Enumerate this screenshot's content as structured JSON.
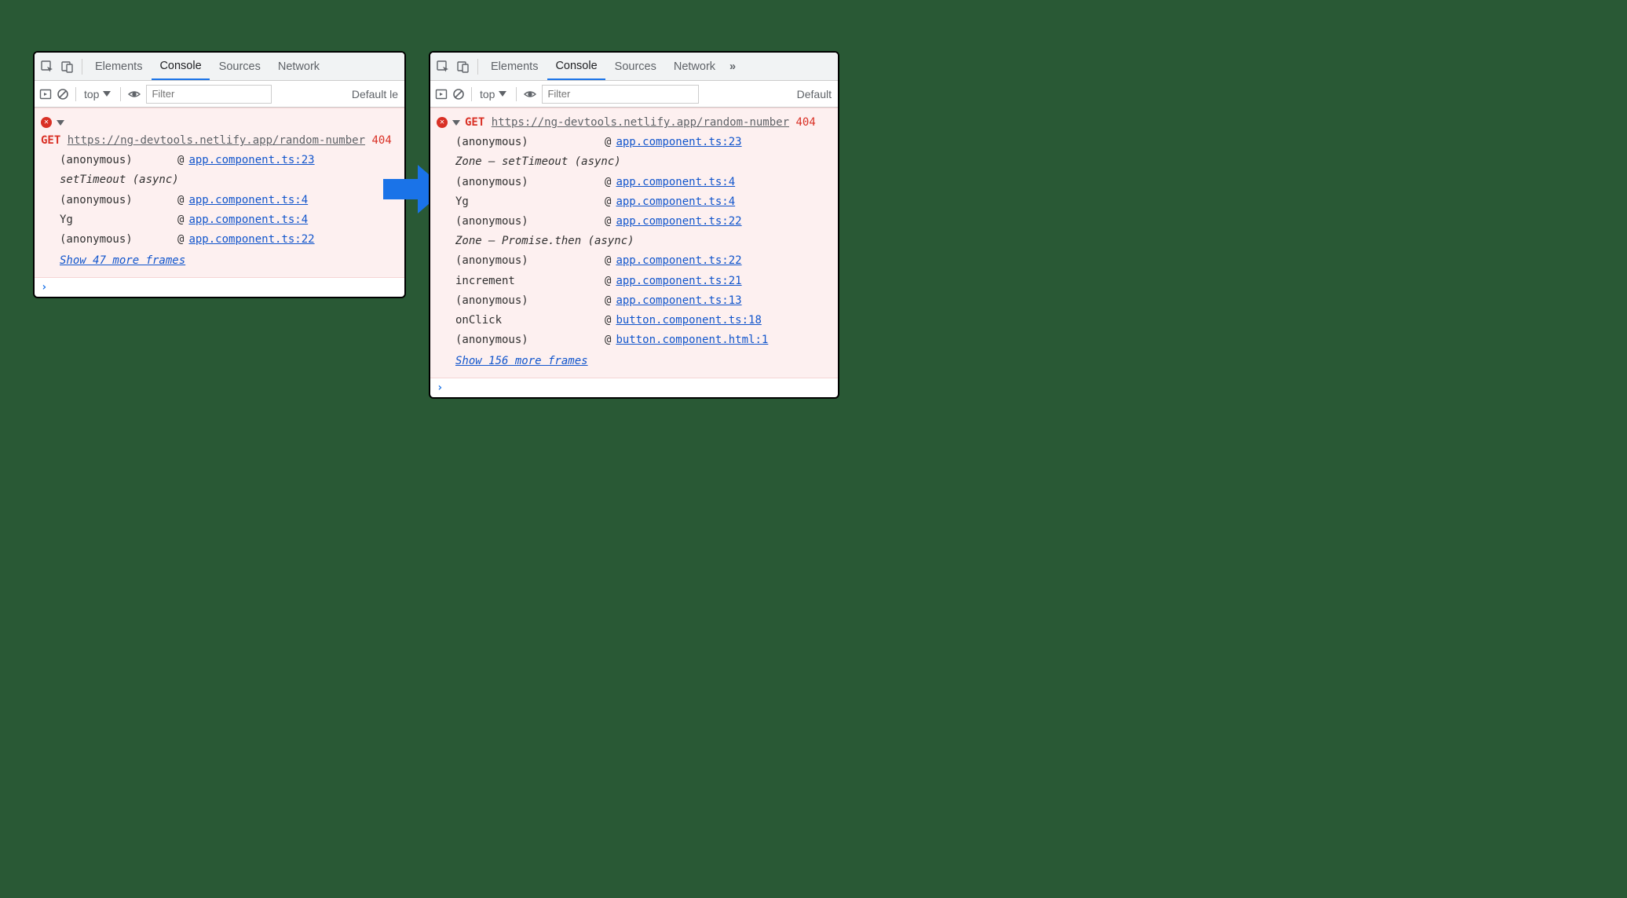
{
  "tabs": {
    "elements": "Elements",
    "console": "Console",
    "sources": "Sources",
    "network": "Network",
    "more": "»"
  },
  "toolbar": {
    "context": "top",
    "filterPlaceholder": "Filter",
    "levelsLeft": "Default le",
    "levelsRight": "Default"
  },
  "request": {
    "method": "GET",
    "url": "https://ng-devtools.netlify.app/random-number",
    "status": "404"
  },
  "left": {
    "rows": [
      {
        "fn": "(anonymous)",
        "link": "app.component.ts:23"
      }
    ],
    "async1": "setTimeout (async)",
    "rows2": [
      {
        "fn": "(anonymous)",
        "link": "app.component.ts:4"
      },
      {
        "fn": "Yg",
        "link": "app.component.ts:4"
      },
      {
        "fn": "(anonymous)",
        "link": "app.component.ts:22"
      }
    ],
    "showMore": "Show 47 more frames"
  },
  "right": {
    "rows": [
      {
        "fn": "(anonymous)",
        "link": "app.component.ts:23"
      }
    ],
    "async1": "Zone — setTimeout (async)",
    "rows2": [
      {
        "fn": "(anonymous)",
        "link": "app.component.ts:4"
      },
      {
        "fn": "Yg",
        "link": "app.component.ts:4"
      },
      {
        "fn": "(anonymous)",
        "link": "app.component.ts:22"
      }
    ],
    "async2": "Zone — Promise.then (async)",
    "rows3": [
      {
        "fn": "(anonymous)",
        "link": "app.component.ts:22"
      },
      {
        "fn": "increment",
        "link": "app.component.ts:21"
      },
      {
        "fn": "(anonymous)",
        "link": "app.component.ts:13"
      },
      {
        "fn": "onClick",
        "link": "button.component.ts:18"
      },
      {
        "fn": "(anonymous)",
        "link": "button.component.html:1"
      }
    ],
    "showMore": "Show 156 more frames"
  },
  "prompt": "›"
}
